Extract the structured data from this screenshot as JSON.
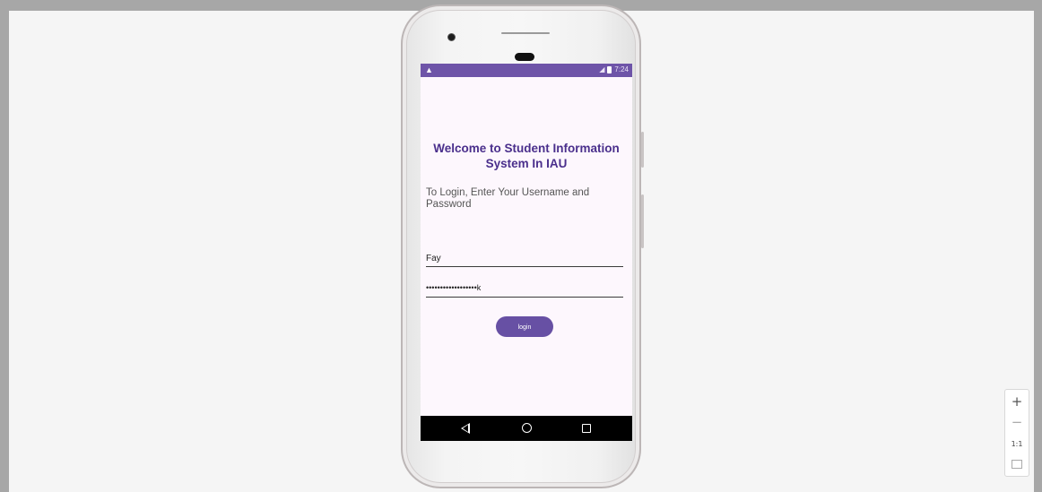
{
  "status_bar": {
    "warning_icon": "warning-icon",
    "time": "7:24",
    "signal_icon": "signal-icon",
    "battery_icon": "battery-icon",
    "color": "#6e54a8"
  },
  "app": {
    "title": "Welcome to Student Information System In IAU",
    "instructions": "To Login, Enter Your Username and Password",
    "username_value": "Fay",
    "password_value": "••••••••••••••••••k",
    "login_label": "login",
    "accent_color": "#6750a4"
  },
  "nav_bar": {
    "back_icon": "back-triangle-icon",
    "home_icon": "home-circle-icon",
    "recents_icon": "recents-square-icon"
  },
  "zoom_controls": {
    "zoom_in_label": "+",
    "zoom_out_label": "−",
    "reset_label": "1:1",
    "fit_icon": "fit-screen-icon"
  }
}
